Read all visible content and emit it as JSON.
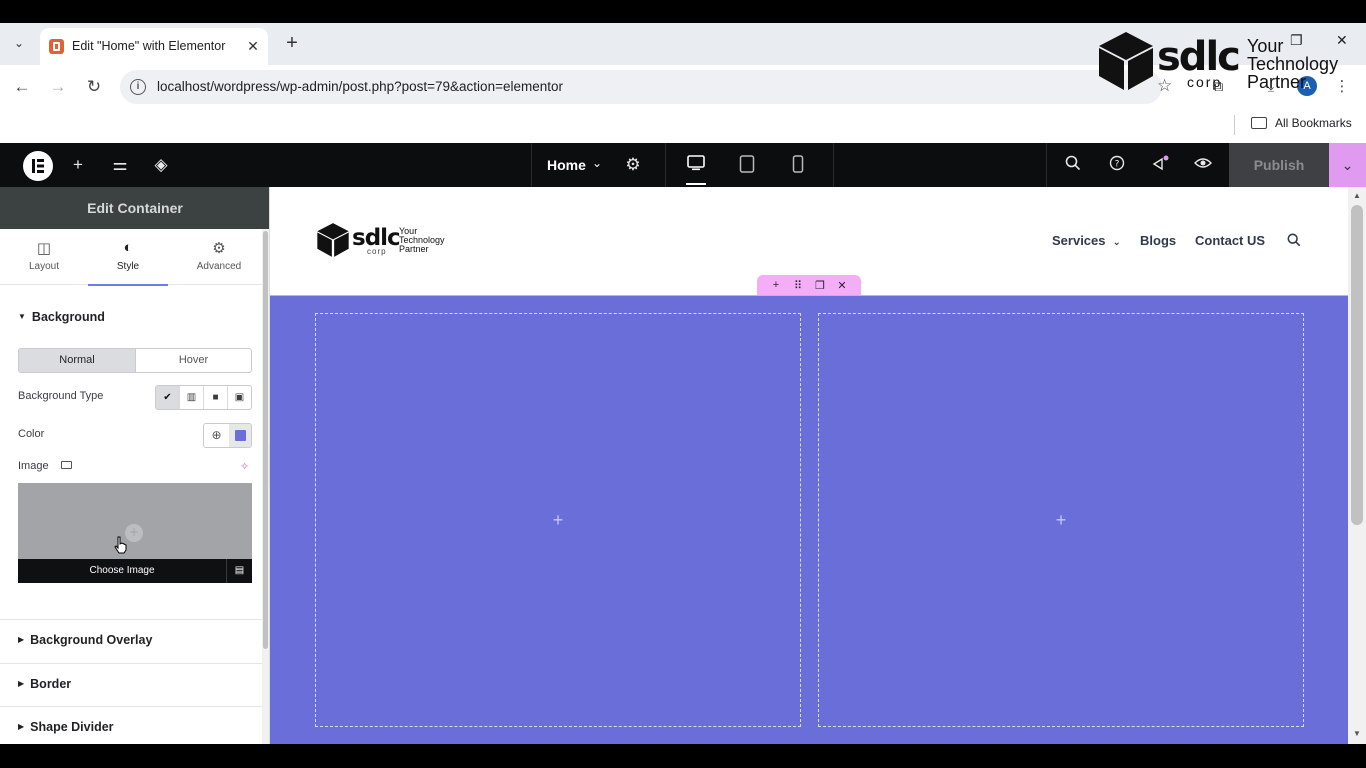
{
  "browser": {
    "tab_title": "Edit \"Home\" with Elementor",
    "tab_close": "✕",
    "new_tab": "+",
    "url": "localhost/wordpress/wp-admin/post.php?post=79&action=elementor",
    "bookmarks_label": "All Bookmarks",
    "profile_initial": "A"
  },
  "watermark": {
    "brand": "sdlc",
    "corp": "corp",
    "tagline": [
      "Your",
      "Technology",
      "Partner"
    ]
  },
  "elementor": {
    "page_selector": "Home",
    "publish_label": "Publish",
    "accent_color": "#e09bf0"
  },
  "panel": {
    "title": "Edit Container",
    "tabs": [
      {
        "label": "Layout",
        "icon": "layout-icon"
      },
      {
        "label": "Style",
        "icon": "style-icon"
      },
      {
        "label": "Advanced",
        "icon": "gear-icon"
      }
    ],
    "active_tab": "Style",
    "background_section": "Background",
    "state_options": [
      "Normal",
      "Hover"
    ],
    "active_state": "Normal",
    "background_type_label": "Background Type",
    "color_label": "Color",
    "color_value": "#6a6ed9",
    "image_label": "Image",
    "choose_image_label": "Choose Image",
    "collapsed_sections": [
      "Background Overlay",
      "Border",
      "Shape Divider"
    ]
  },
  "site": {
    "logo_brand": "sdlc",
    "logo_corp": "corp",
    "logo_tagline": [
      "Your",
      "Technology",
      "Partner"
    ],
    "nav": [
      "Services",
      "Blogs",
      "Contact US"
    ],
    "section_color": "#6a6ed9"
  }
}
